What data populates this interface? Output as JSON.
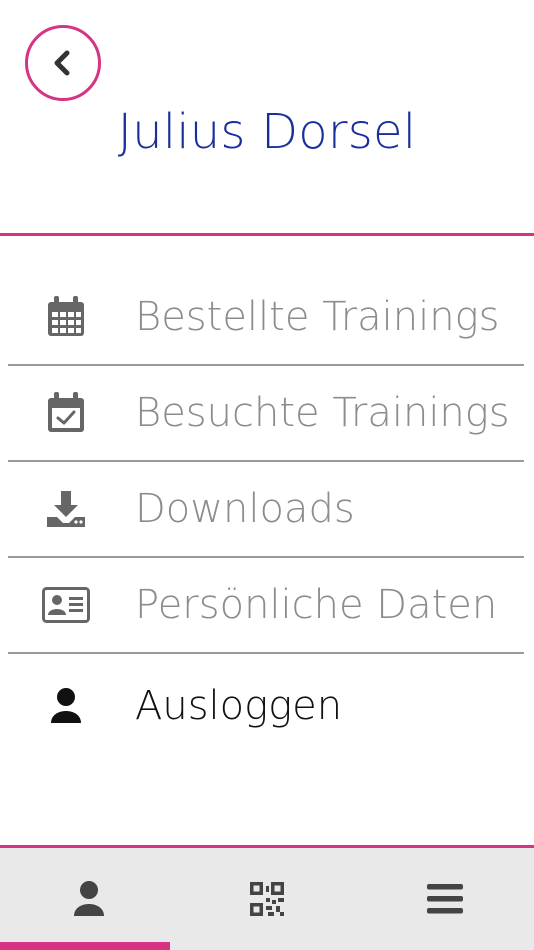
{
  "header": {
    "title": "Julius Dorsel",
    "back_icon": "chevron-left-icon",
    "accent_color": "#d63384",
    "title_color": "#1a2f9a"
  },
  "menu": {
    "items": [
      {
        "label": "Bestellte Trainings",
        "icon": "calendar-icon"
      },
      {
        "label": "Besuchte Trainings",
        "icon": "calendar-check-icon"
      },
      {
        "label": "Downloads",
        "icon": "download-icon"
      },
      {
        "label": "Persönliche Daten",
        "icon": "id-card-icon"
      },
      {
        "label": "Ausloggen",
        "icon": "user-icon"
      }
    ]
  },
  "tabbar": {
    "tabs": [
      {
        "icon": "user-icon",
        "active": true
      },
      {
        "icon": "qr-code-icon",
        "active": false
      },
      {
        "icon": "hamburger-menu-icon",
        "active": false
      }
    ]
  }
}
